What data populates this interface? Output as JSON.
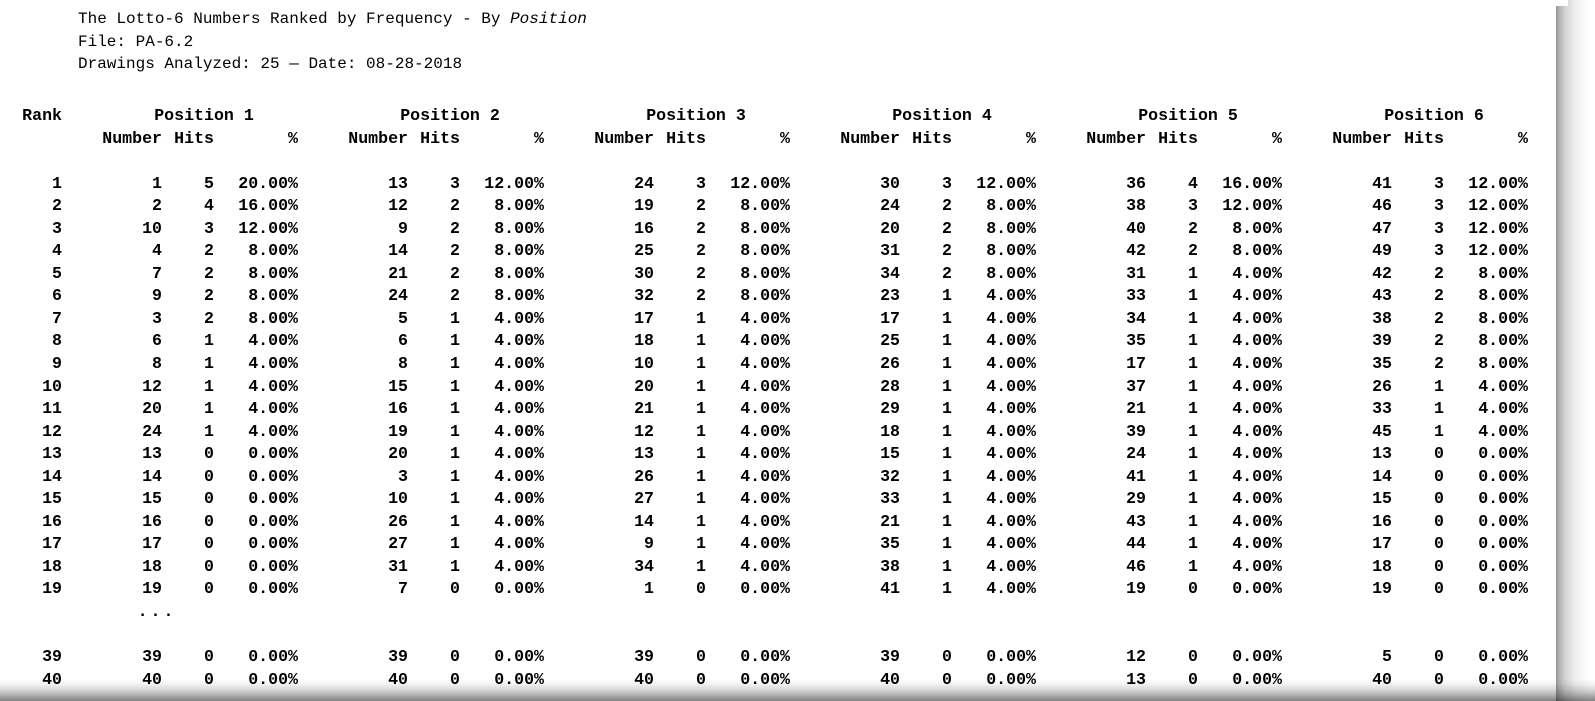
{
  "report": {
    "title_prefix": "The Lotto-6 Numbers Ranked by Frequency - By ",
    "title_italic": "Position",
    "file_line": "File: PA-6.2",
    "drawings_line": "Drawings Analyzed: 25 — Date: 08-28-2018",
    "drawings_analyzed": "25",
    "date": "08-28-2018",
    "file": "PA-6.2",
    "ellipsis": "..."
  },
  "headers": {
    "rank": "Rank",
    "groups": [
      "Position 1",
      "Position 2",
      "Position 3",
      "Position 4",
      "Position 5",
      "Position 6"
    ],
    "sub": {
      "number": "Number",
      "hits": "Hits",
      "pct": "%"
    }
  },
  "chart_data": {
    "type": "table",
    "title": "The Lotto-6 Numbers Ranked by Frequency - By Position",
    "columns": [
      "Rank",
      "Number",
      "Hits",
      "%"
    ],
    "groups": [
      "Position 1",
      "Position 2",
      "Position 3",
      "Position 4",
      "Position 5",
      "Position 6"
    ],
    "rows": [
      {
        "rank": "1",
        "cells": [
          {
            "number": "1",
            "hits": "5",
            "pct": "20.00%"
          },
          {
            "number": "13",
            "hits": "3",
            "pct": "12.00%"
          },
          {
            "number": "24",
            "hits": "3",
            "pct": "12.00%"
          },
          {
            "number": "30",
            "hits": "3",
            "pct": "12.00%"
          },
          {
            "number": "36",
            "hits": "4",
            "pct": "16.00%"
          },
          {
            "number": "41",
            "hits": "3",
            "pct": "12.00%"
          }
        ]
      },
      {
        "rank": "2",
        "cells": [
          {
            "number": "2",
            "hits": "4",
            "pct": "16.00%"
          },
          {
            "number": "12",
            "hits": "2",
            "pct": "8.00%"
          },
          {
            "number": "19",
            "hits": "2",
            "pct": "8.00%"
          },
          {
            "number": "24",
            "hits": "2",
            "pct": "8.00%"
          },
          {
            "number": "38",
            "hits": "3",
            "pct": "12.00%"
          },
          {
            "number": "46",
            "hits": "3",
            "pct": "12.00%"
          }
        ]
      },
      {
        "rank": "3",
        "cells": [
          {
            "number": "10",
            "hits": "3",
            "pct": "12.00%"
          },
          {
            "number": "9",
            "hits": "2",
            "pct": "8.00%"
          },
          {
            "number": "16",
            "hits": "2",
            "pct": "8.00%"
          },
          {
            "number": "20",
            "hits": "2",
            "pct": "8.00%"
          },
          {
            "number": "40",
            "hits": "2",
            "pct": "8.00%"
          },
          {
            "number": "47",
            "hits": "3",
            "pct": "12.00%"
          }
        ]
      },
      {
        "rank": "4",
        "cells": [
          {
            "number": "4",
            "hits": "2",
            "pct": "8.00%"
          },
          {
            "number": "14",
            "hits": "2",
            "pct": "8.00%"
          },
          {
            "number": "25",
            "hits": "2",
            "pct": "8.00%"
          },
          {
            "number": "31",
            "hits": "2",
            "pct": "8.00%"
          },
          {
            "number": "42",
            "hits": "2",
            "pct": "8.00%"
          },
          {
            "number": "49",
            "hits": "3",
            "pct": "12.00%"
          }
        ]
      },
      {
        "rank": "5",
        "cells": [
          {
            "number": "7",
            "hits": "2",
            "pct": "8.00%"
          },
          {
            "number": "21",
            "hits": "2",
            "pct": "8.00%"
          },
          {
            "number": "30",
            "hits": "2",
            "pct": "8.00%"
          },
          {
            "number": "34",
            "hits": "2",
            "pct": "8.00%"
          },
          {
            "number": "31",
            "hits": "1",
            "pct": "4.00%"
          },
          {
            "number": "42",
            "hits": "2",
            "pct": "8.00%"
          }
        ]
      },
      {
        "rank": "6",
        "cells": [
          {
            "number": "9",
            "hits": "2",
            "pct": "8.00%"
          },
          {
            "number": "24",
            "hits": "2",
            "pct": "8.00%"
          },
          {
            "number": "32",
            "hits": "2",
            "pct": "8.00%"
          },
          {
            "number": "23",
            "hits": "1",
            "pct": "4.00%"
          },
          {
            "number": "33",
            "hits": "1",
            "pct": "4.00%"
          },
          {
            "number": "43",
            "hits": "2",
            "pct": "8.00%"
          }
        ]
      },
      {
        "rank": "7",
        "cells": [
          {
            "number": "3",
            "hits": "2",
            "pct": "8.00%"
          },
          {
            "number": "5",
            "hits": "1",
            "pct": "4.00%"
          },
          {
            "number": "17",
            "hits": "1",
            "pct": "4.00%"
          },
          {
            "number": "17",
            "hits": "1",
            "pct": "4.00%"
          },
          {
            "number": "34",
            "hits": "1",
            "pct": "4.00%"
          },
          {
            "number": "38",
            "hits": "2",
            "pct": "8.00%"
          }
        ]
      },
      {
        "rank": "8",
        "cells": [
          {
            "number": "6",
            "hits": "1",
            "pct": "4.00%"
          },
          {
            "number": "6",
            "hits": "1",
            "pct": "4.00%"
          },
          {
            "number": "18",
            "hits": "1",
            "pct": "4.00%"
          },
          {
            "number": "25",
            "hits": "1",
            "pct": "4.00%"
          },
          {
            "number": "35",
            "hits": "1",
            "pct": "4.00%"
          },
          {
            "number": "39",
            "hits": "2",
            "pct": "8.00%"
          }
        ]
      },
      {
        "rank": "9",
        "cells": [
          {
            "number": "8",
            "hits": "1",
            "pct": "4.00%"
          },
          {
            "number": "8",
            "hits": "1",
            "pct": "4.00%"
          },
          {
            "number": "10",
            "hits": "1",
            "pct": "4.00%"
          },
          {
            "number": "26",
            "hits": "1",
            "pct": "4.00%"
          },
          {
            "number": "17",
            "hits": "1",
            "pct": "4.00%"
          },
          {
            "number": "35",
            "hits": "2",
            "pct": "8.00%"
          }
        ]
      },
      {
        "rank": "10",
        "cells": [
          {
            "number": "12",
            "hits": "1",
            "pct": "4.00%"
          },
          {
            "number": "15",
            "hits": "1",
            "pct": "4.00%"
          },
          {
            "number": "20",
            "hits": "1",
            "pct": "4.00%"
          },
          {
            "number": "28",
            "hits": "1",
            "pct": "4.00%"
          },
          {
            "number": "37",
            "hits": "1",
            "pct": "4.00%"
          },
          {
            "number": "26",
            "hits": "1",
            "pct": "4.00%"
          }
        ]
      },
      {
        "rank": "11",
        "cells": [
          {
            "number": "20",
            "hits": "1",
            "pct": "4.00%"
          },
          {
            "number": "16",
            "hits": "1",
            "pct": "4.00%"
          },
          {
            "number": "21",
            "hits": "1",
            "pct": "4.00%"
          },
          {
            "number": "29",
            "hits": "1",
            "pct": "4.00%"
          },
          {
            "number": "21",
            "hits": "1",
            "pct": "4.00%"
          },
          {
            "number": "33",
            "hits": "1",
            "pct": "4.00%"
          }
        ]
      },
      {
        "rank": "12",
        "cells": [
          {
            "number": "24",
            "hits": "1",
            "pct": "4.00%"
          },
          {
            "number": "19",
            "hits": "1",
            "pct": "4.00%"
          },
          {
            "number": "12",
            "hits": "1",
            "pct": "4.00%"
          },
          {
            "number": "18",
            "hits": "1",
            "pct": "4.00%"
          },
          {
            "number": "39",
            "hits": "1",
            "pct": "4.00%"
          },
          {
            "number": "45",
            "hits": "1",
            "pct": "4.00%"
          }
        ]
      },
      {
        "rank": "13",
        "cells": [
          {
            "number": "13",
            "hits": "0",
            "pct": "0.00%"
          },
          {
            "number": "20",
            "hits": "1",
            "pct": "4.00%"
          },
          {
            "number": "13",
            "hits": "1",
            "pct": "4.00%"
          },
          {
            "number": "15",
            "hits": "1",
            "pct": "4.00%"
          },
          {
            "number": "24",
            "hits": "1",
            "pct": "4.00%"
          },
          {
            "number": "13",
            "hits": "0",
            "pct": "0.00%"
          }
        ]
      },
      {
        "rank": "14",
        "cells": [
          {
            "number": "14",
            "hits": "0",
            "pct": "0.00%"
          },
          {
            "number": "3",
            "hits": "1",
            "pct": "4.00%"
          },
          {
            "number": "26",
            "hits": "1",
            "pct": "4.00%"
          },
          {
            "number": "32",
            "hits": "1",
            "pct": "4.00%"
          },
          {
            "number": "41",
            "hits": "1",
            "pct": "4.00%"
          },
          {
            "number": "14",
            "hits": "0",
            "pct": "0.00%"
          }
        ]
      },
      {
        "rank": "15",
        "cells": [
          {
            "number": "15",
            "hits": "0",
            "pct": "0.00%"
          },
          {
            "number": "10",
            "hits": "1",
            "pct": "4.00%"
          },
          {
            "number": "27",
            "hits": "1",
            "pct": "4.00%"
          },
          {
            "number": "33",
            "hits": "1",
            "pct": "4.00%"
          },
          {
            "number": "29",
            "hits": "1",
            "pct": "4.00%"
          },
          {
            "number": "15",
            "hits": "0",
            "pct": "0.00%"
          }
        ]
      },
      {
        "rank": "16",
        "cells": [
          {
            "number": "16",
            "hits": "0",
            "pct": "0.00%"
          },
          {
            "number": "26",
            "hits": "1",
            "pct": "4.00%"
          },
          {
            "number": "14",
            "hits": "1",
            "pct": "4.00%"
          },
          {
            "number": "21",
            "hits": "1",
            "pct": "4.00%"
          },
          {
            "number": "43",
            "hits": "1",
            "pct": "4.00%"
          },
          {
            "number": "16",
            "hits": "0",
            "pct": "0.00%"
          }
        ]
      },
      {
        "rank": "17",
        "cells": [
          {
            "number": "17",
            "hits": "0",
            "pct": "0.00%"
          },
          {
            "number": "27",
            "hits": "1",
            "pct": "4.00%"
          },
          {
            "number": "9",
            "hits": "1",
            "pct": "4.00%"
          },
          {
            "number": "35",
            "hits": "1",
            "pct": "4.00%"
          },
          {
            "number": "44",
            "hits": "1",
            "pct": "4.00%"
          },
          {
            "number": "17",
            "hits": "0",
            "pct": "0.00%"
          }
        ]
      },
      {
        "rank": "18",
        "cells": [
          {
            "number": "18",
            "hits": "0",
            "pct": "0.00%"
          },
          {
            "number": "31",
            "hits": "1",
            "pct": "4.00%"
          },
          {
            "number": "34",
            "hits": "1",
            "pct": "4.00%"
          },
          {
            "number": "38",
            "hits": "1",
            "pct": "4.00%"
          },
          {
            "number": "46",
            "hits": "1",
            "pct": "4.00%"
          },
          {
            "number": "18",
            "hits": "0",
            "pct": "0.00%"
          }
        ]
      },
      {
        "rank": "19",
        "cells": [
          {
            "number": "19",
            "hits": "0",
            "pct": "0.00%"
          },
          {
            "number": "7",
            "hits": "0",
            "pct": "0.00%"
          },
          {
            "number": "1",
            "hits": "0",
            "pct": "0.00%"
          },
          {
            "number": "41",
            "hits": "1",
            "pct": "4.00%"
          },
          {
            "number": "19",
            "hits": "0",
            "pct": "0.00%"
          },
          {
            "number": "19",
            "hits": "0",
            "pct": "0.00%"
          }
        ]
      },
      {
        "rank": "39",
        "cells": [
          {
            "number": "39",
            "hits": "0",
            "pct": "0.00%"
          },
          {
            "number": "39",
            "hits": "0",
            "pct": "0.00%"
          },
          {
            "number": "39",
            "hits": "0",
            "pct": "0.00%"
          },
          {
            "number": "39",
            "hits": "0",
            "pct": "0.00%"
          },
          {
            "number": "12",
            "hits": "0",
            "pct": "0.00%"
          },
          {
            "number": "5",
            "hits": "0",
            "pct": "0.00%"
          }
        ]
      },
      {
        "rank": "40",
        "cells": [
          {
            "number": "40",
            "hits": "0",
            "pct": "0.00%"
          },
          {
            "number": "40",
            "hits": "0",
            "pct": "0.00%"
          },
          {
            "number": "40",
            "hits": "0",
            "pct": "0.00%"
          },
          {
            "number": "40",
            "hits": "0",
            "pct": "0.00%"
          },
          {
            "number": "13",
            "hits": "0",
            "pct": "0.00%"
          },
          {
            "number": "40",
            "hits": "0",
            "pct": "0.00%"
          }
        ]
      }
    ]
  }
}
